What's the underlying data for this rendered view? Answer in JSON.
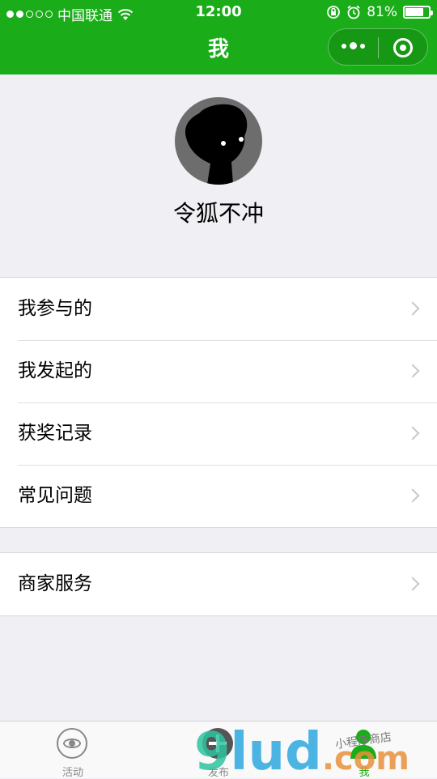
{
  "status_bar": {
    "carrier": "中国联通",
    "time": "12:00",
    "battery": "81%",
    "battery_level": 0.81
  },
  "nav": {
    "title": "我"
  },
  "profile": {
    "username": "令狐不冲"
  },
  "menu_group_1": [
    {
      "label": "我参与的"
    },
    {
      "label": "我发起的"
    },
    {
      "label": "获奖记录"
    },
    {
      "label": "常见问题"
    }
  ],
  "menu_group_2": [
    {
      "label": "商家服务"
    }
  ],
  "tabbar": {
    "tabs": [
      {
        "label": "活动",
        "icon": "eye-icon"
      },
      {
        "label": "发布",
        "icon": "plus-circle-icon"
      },
      {
        "label": "我",
        "icon": "person-icon"
      }
    ],
    "active": "我"
  },
  "watermark": {
    "brand": "9lud.com",
    "tagline": "小程序商店"
  },
  "colors": {
    "brand_green": "#1aad19",
    "background": "#efeff4"
  }
}
